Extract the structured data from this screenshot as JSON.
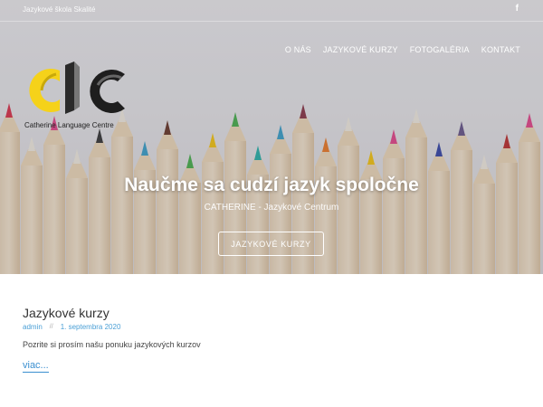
{
  "site": {
    "tagline": "Jazykové škola Skalité",
    "facebook_icon": "f",
    "logo_text": "Catherine Language Centre"
  },
  "nav": {
    "items": [
      {
        "label": "O NÁS"
      },
      {
        "label": "JAZYKOVÉ KURZY"
      },
      {
        "label": "FOTOGALÉRIA"
      },
      {
        "label": "KONTAKT"
      }
    ]
  },
  "hero": {
    "title": "Naučme sa cudzí jazyk spoločne",
    "subtitle": "CATHERINE - Jazykové Centrum",
    "button_label": "JAZYKOVÉ KURZY"
  },
  "post": {
    "title": "Jazykové kurzy",
    "author": "admin",
    "separator": "//",
    "date": "1. septembra 2020",
    "excerpt": "Pozrite si prosím našu ponuku jazykových kurzov",
    "more_label": "viac..."
  },
  "colors": {
    "accent": "#3a8fd0",
    "logo_yellow": "#f5d21a",
    "logo_dark": "#222222"
  }
}
